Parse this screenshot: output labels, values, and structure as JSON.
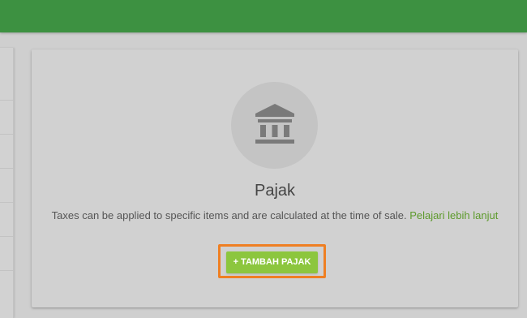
{
  "header": {
    "color": "#3d9141"
  },
  "empty_state": {
    "icon": "bank-icon",
    "title": "Pajak",
    "description": "Taxes can be applied to specific items and are calculated at the time of sale.",
    "learn_more_link": "Pelajari lebih lanjut",
    "add_button_label": "+ TAMBAH PAJAK"
  },
  "colors": {
    "accent_button": "#8cc63e",
    "highlight_outline": "#ef7f22",
    "link": "#5d9a2c"
  }
}
